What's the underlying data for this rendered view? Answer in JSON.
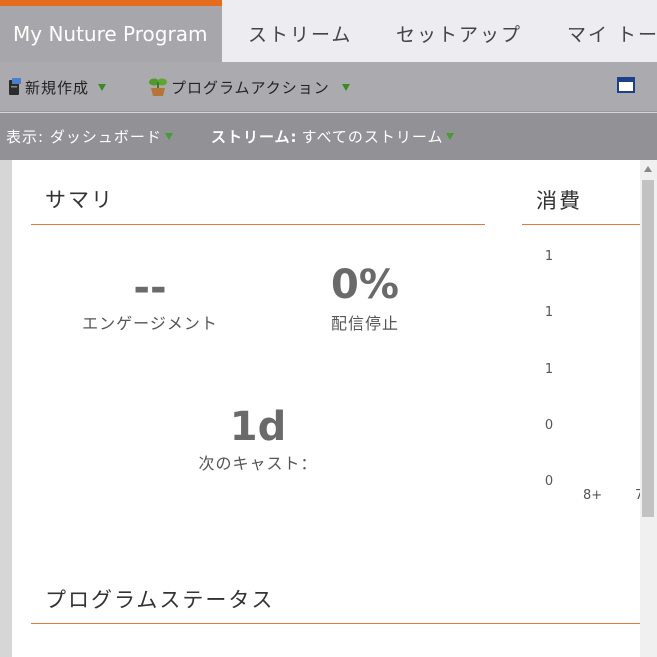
{
  "tabs": {
    "active": "My Nuture Program",
    "items": [
      "ストリーム",
      "セットアップ",
      "マイ トー"
    ]
  },
  "toolbar": {
    "new_label": "新規作成",
    "action_label": "プログラムアクション"
  },
  "viewbar": {
    "view_label": "表示:",
    "view_value": "ダッシュボード",
    "stream_label": "ストリーム:",
    "stream_value": "すべてのストリーム"
  },
  "summary": {
    "title": "サマリ",
    "engagement_value": "--",
    "engagement_label": "エンゲージメント",
    "unsubscribe_value": "0%",
    "unsubscribe_label": "配信停止",
    "next_cast_value": "1d",
    "next_cast_label": "次のキャスト："
  },
  "consumption": {
    "title": "消費"
  },
  "chart_data": {
    "type": "bar",
    "title": "消費",
    "y_ticks": [
      "1",
      "1",
      "1",
      "0",
      "0"
    ],
    "x_ticks": [
      "8+",
      "7"
    ]
  },
  "program_status": {
    "title": "プログラムステータス"
  },
  "colors": {
    "accent": "#e36c1d",
    "active_tab": "#a6a6ab",
    "toolbar": "#ababaf",
    "viewbar": "#919196",
    "dropdown_triangle": "#3a8a2a"
  }
}
